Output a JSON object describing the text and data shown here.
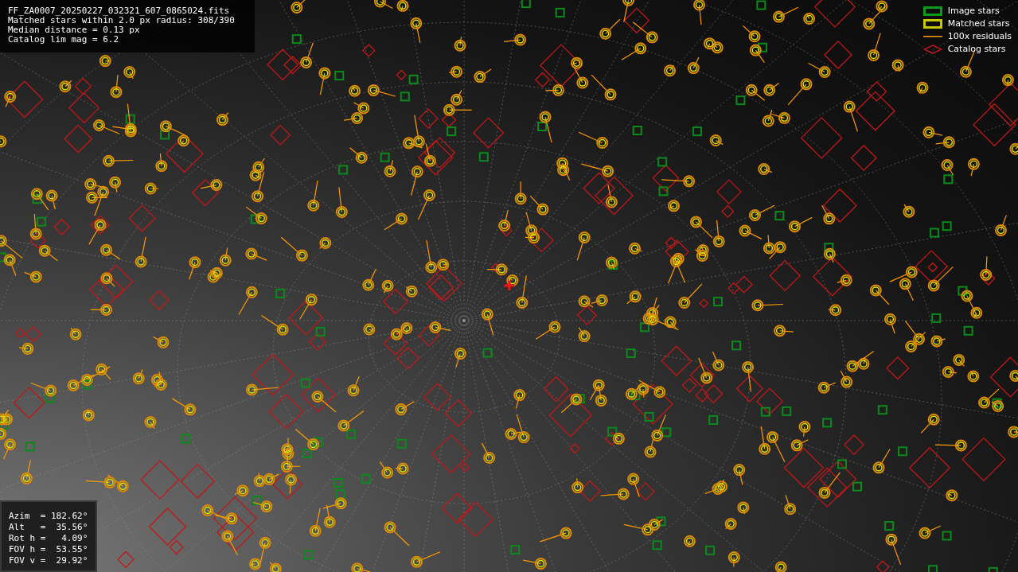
{
  "info": {
    "lines": [
      "FF_ZA0007_20250227_032321_607_0865024.fits",
      "Matched stars within 2.0 px radius: 308/390",
      "Median distance = 0.13 px",
      "Catalog lim mag = 6.2"
    ]
  },
  "legend": [
    {
      "kind": "image",
      "label": "Image stars"
    },
    {
      "kind": "matched",
      "label": "Matched stars"
    },
    {
      "kind": "residual",
      "label": "100x residuals"
    },
    {
      "kind": "catalog",
      "label": "Catalog stars"
    }
  ],
  "pointing": {
    "lines": [
      "Azim  = 182.62°",
      "Alt   =  35.56°",
      "Rot h =   4.09°",
      "FOV h =  53.55°",
      "FOV v =  29.92°"
    ]
  }
}
